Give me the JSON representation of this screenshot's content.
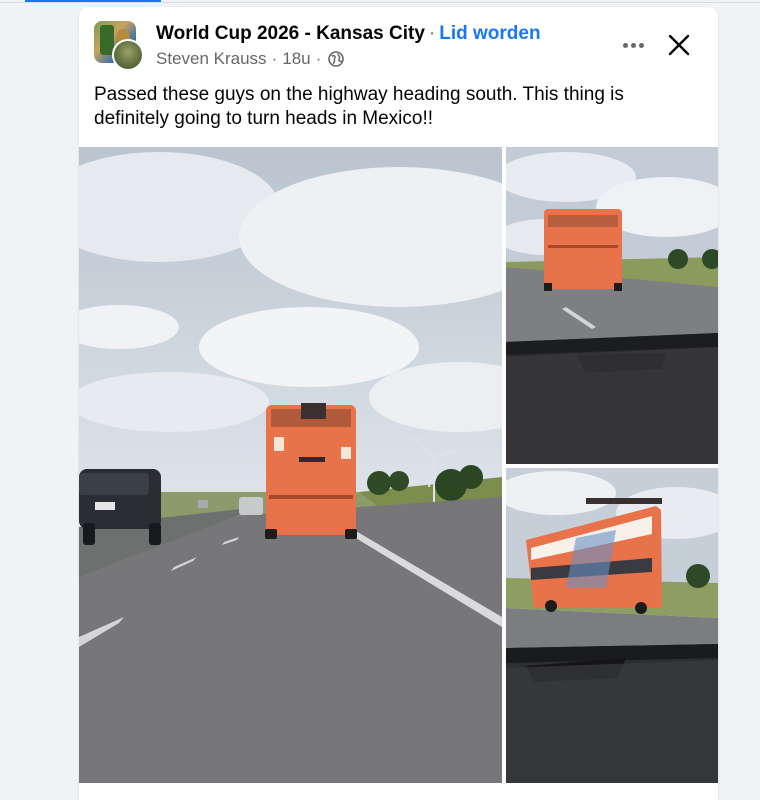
{
  "post": {
    "group_name": "World Cup 2026 - Kansas City",
    "separator": "·",
    "join_label": "Lid worden",
    "author": "Steven Krauss",
    "time": "18u",
    "privacy_icon": "globe-icon",
    "text": "Passed these guys on the highway heading south. This thing is definitely going to turn heads in Mexico!!",
    "more_icon": "more-options-icon",
    "close_icon": "close-icon"
  },
  "photos": [
    {
      "name": "photo-bus-highway-wide",
      "subject": "orange double-decker bus on highway"
    },
    {
      "name": "photo-bus-rear-dashboard",
      "subject": "orange double-decker bus viewed through windshield"
    },
    {
      "name": "photo-bus-side-dashboard",
      "subject": "orange double-decker bus side view through windshield"
    }
  ],
  "colors": {
    "accent": "#1877f2",
    "bus_orange": "#e8734a",
    "sky": "#c9d3de",
    "road": "#77777a"
  }
}
